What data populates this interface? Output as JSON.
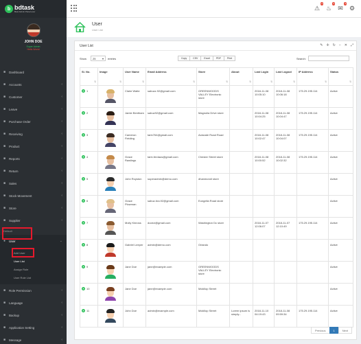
{
  "brand": {
    "name": "bdtask",
    "tagline": "Best Admin Panel ever"
  },
  "profile": {
    "name": "JOHN DOE",
    "status": "Super Admin",
    "role": "Hello World"
  },
  "sidebar": {
    "items": [
      {
        "label": "Dashboard",
        "icon": "home-icon",
        "chevron": false
      },
      {
        "label": "Accounts",
        "icon": "calculator-icon",
        "chevron": true
      },
      {
        "label": "Customer",
        "icon": "user-icon",
        "chevron": true
      },
      {
        "label": "Leave",
        "icon": "calendar-icon",
        "chevron": true
      },
      {
        "label": "Purchase Order",
        "icon": "cart-icon",
        "chevron": true
      },
      {
        "label": "Receiving",
        "icon": "truck-icon",
        "chevron": true
      },
      {
        "label": "Product",
        "icon": "box-icon",
        "chevron": true
      },
      {
        "label": "Reports",
        "icon": "chart-icon",
        "chevron": true
      },
      {
        "label": "Return",
        "icon": "return-icon",
        "chevron": true
      },
      {
        "label": "Sales",
        "icon": "sales-icon",
        "chevron": true
      },
      {
        "label": "Stock Movement",
        "icon": "stock-icon",
        "chevron": true
      },
      {
        "label": "Store",
        "icon": "store-icon",
        "chevron": true
      },
      {
        "label": "Supplier",
        "icon": "supplier-icon",
        "chevron": true
      }
    ],
    "section_label": "Default",
    "user_menu": {
      "label": "User",
      "sub_items": [
        "Add User",
        "User List",
        "Assign Role",
        "User Role List"
      ]
    },
    "bottom_items": [
      {
        "label": "Role Permission",
        "icon": "key-icon"
      },
      {
        "label": "Language",
        "icon": "language-icon"
      },
      {
        "label": "Backup",
        "icon": "database-icon"
      },
      {
        "label": "Application Setting",
        "icon": "settings-icon"
      },
      {
        "label": "Message",
        "icon": "message-icon"
      }
    ]
  },
  "topbar": {
    "badges": {
      "alert": "2",
      "bell": "3",
      "mail": "4"
    }
  },
  "header": {
    "title": "User",
    "subtitle": "User List"
  },
  "panel": {
    "title": "User List"
  },
  "controls": {
    "show_label": "Show",
    "show_value": "25",
    "entries_label": "entries",
    "buttons": [
      "Copy",
      "CSV",
      "Excel",
      "PDF",
      "Print"
    ],
    "search_label": "Search:",
    "search_placeholder": ""
  },
  "table": {
    "headers": [
      "Sl. No.",
      "Image",
      "User Name",
      "Email Address",
      "Store",
      "About",
      "Last Login",
      "Last Logout",
      "IP Address",
      "Status"
    ],
    "rows": [
      {
        "sl": "1",
        "name": "Claire Waite",
        "email": "sabuzz.92@gmail.com",
        "store": "GREENWOODS VALLEY Electronic store",
        "about": "",
        "login": "2018-11-08 10:05:10",
        "logout": "2018-11-08 10:06:18",
        "ip": "175.29.195.114",
        "status": "Active"
      },
      {
        "sl": "2",
        "name": "Jamie Bentham",
        "email": "sabuz92@gmail.com",
        "store": "Magnolia Drive store",
        "about": "",
        "login": "2018-11-08 10:04:25",
        "logout": "2018-11-08 10:04:47",
        "ip": "175.29.195.114",
        "status": "Active"
      },
      {
        "sl": "3",
        "name": "Cameron Fielding",
        "email": "tarin764@gmail.com",
        "store": "Aclavale Road Road",
        "about": "",
        "login": "2018-11-08 10:02:47",
        "logout": "2018-11-08 10:04:07",
        "ip": "175.29.195.114",
        "status": "Active"
      },
      {
        "sl": "4",
        "name": "Grace Rawlings",
        "email": "tarin.ferdaus@gmail.com",
        "store": "Chester Street store",
        "about": "",
        "login": "2018-11-08 10:00:52",
        "logout": "2018-11-08 10:02:32",
        "ip": "175.29.195.114",
        "status": "Active"
      },
      {
        "sl": "5",
        "name": "John Royston",
        "email": "superadmin@demo.com",
        "store": "dhanmondi store",
        "about": "",
        "login": "",
        "logout": "",
        "ip": "",
        "status": "Active"
      },
      {
        "sl": "6",
        "name": "Grace Plowman",
        "email": "sabuz.bra.92@gmail.com",
        "store": "Eungella Road store",
        "about": "",
        "login": "",
        "logout": "",
        "ip": "",
        "status": "Active"
      },
      {
        "sl": "7",
        "name": "Molly Kinross",
        "email": "doctor@gmail.com",
        "store": "Washington Dc store",
        "about": "",
        "login": "2018-11-07 12:06:07",
        "logout": "2018-11-07 12:10:49",
        "ip": "175.29.195.114",
        "status": "Active"
      },
      {
        "sl": "8",
        "name": "Gabriel Leeper",
        "email": "admin@demo.com",
        "store": "Orlando",
        "about": "",
        "login": "",
        "logout": "",
        "ip": "",
        "status": "Active"
      },
      {
        "sl": "9",
        "name": "Jane Doe",
        "email": "jane@example.com",
        "store": "GREENWOODS VALLEY Electronic store",
        "about": "",
        "login": "",
        "logout": "",
        "ip": "",
        "status": "Active"
      },
      {
        "sl": "10",
        "name": "Jane Doe",
        "email": "jane@example.com",
        "store": "Mckillop Street",
        "about": "",
        "login": "",
        "logout": "",
        "ip": "",
        "status": "Active"
      },
      {
        "sl": "11",
        "name": "John Doe",
        "email": "admin@example.com",
        "store": "Mckillop Street",
        "about": "Lorem ipsum is simply...",
        "login": "2018-11-10 04:19:43",
        "logout": "2018-11-08 09:59:34",
        "ip": "175.29.195.114",
        "status": "Active"
      }
    ]
  },
  "pagination": {
    "previous": "Previous",
    "current": "1",
    "next": "Next"
  },
  "colors": {
    "sidebar": "#2b2f33",
    "accent_green": "#2ec15b",
    "highlight_red": "#e8192c",
    "pagination_blue": "#337ab7"
  }
}
